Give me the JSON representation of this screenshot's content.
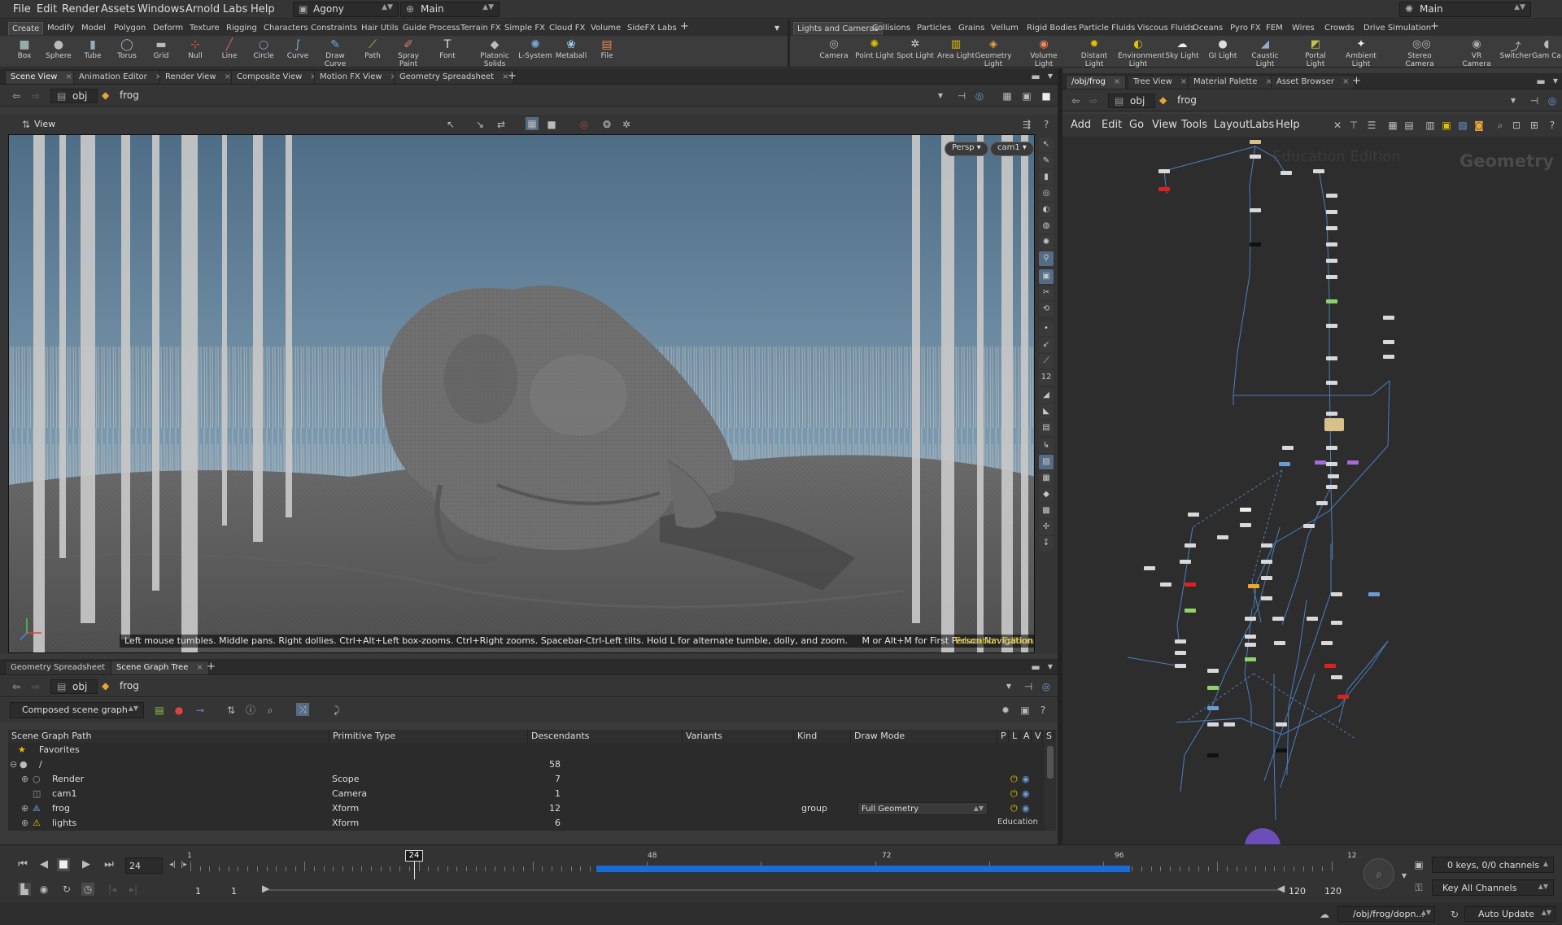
{
  "menu": [
    "File",
    "Edit",
    "Render",
    "Assets",
    "Windows",
    "Arnold",
    "Labs",
    "Help"
  ],
  "desktop": "Agony",
  "context": "Main",
  "right_context": "Main",
  "shelf_tabs_left": [
    "Create",
    "Modify",
    "Model",
    "Polygon",
    "Deform",
    "Texture",
    "Rigging",
    "Characters",
    "Constraints",
    "Hair Utils",
    "Guide Process",
    "Terrain FX",
    "Simple FX",
    "Cloud FX",
    "Volume",
    "SideFX Labs"
  ],
  "shelf_tabs_right": [
    "Lights and Cameras",
    "Collisions",
    "Particles",
    "Grains",
    "Vellum",
    "Rigid Bodies",
    "Particle Fluids",
    "Viscous Fluids",
    "Oceans",
    "Pyro FX",
    "FEM",
    "Wires",
    "Crowds",
    "Drive Simulation"
  ],
  "tools_left": [
    "Box",
    "Sphere",
    "Tube",
    "Torus",
    "Grid",
    "Null",
    "Line",
    "Circle",
    "Curve",
    "Draw Curve",
    "Path",
    "Spray Paint",
    "Font",
    "Platonic Solids",
    "L-System",
    "Metaball",
    "File"
  ],
  "tools_right": [
    "Camera",
    "Point Light",
    "Spot Light",
    "Area Light",
    "Geometry Light",
    "Volume Light",
    "Distant Light",
    "Environment Light",
    "Sky Light",
    "GI Light",
    "Caustic Light",
    "Portal Light",
    "Ambient Light",
    "VR Camera",
    "Switcher",
    "Gam Ca"
  ],
  "tools_right_extra": [
    "Stereo Camera"
  ],
  "pane_tabs_top": [
    "Scene View",
    "Animation Editor",
    "Render View",
    "Composite View",
    "Motion FX View",
    "Geometry Spreadsheet"
  ],
  "pane_tabs_right": [
    "/obj/frog",
    "Tree View",
    "Material Palette",
    "Asset Browser"
  ],
  "path": {
    "obj": "obj",
    "node": "frog"
  },
  "view": {
    "title": "View",
    "persp": "Persp",
    "cam": "cam1",
    "hint": "Left mouse tumbles. Middle pans. Right dollies. Ctrl+Alt+Left box-zooms. Ctrl+Right zooms. Spacebar-Ctrl-Left tilts. Hold L for alternate tumble, dolly, and zoom.     M or Alt+M for First Person Navigation.",
    "edu": "Education Edition"
  },
  "network": {
    "menus": [
      "Add",
      "Edit",
      "Go",
      "View",
      "Tools",
      "Layout",
      "Labs",
      "Help"
    ],
    "watermark": "Geometry",
    "edu_watermark": "Education Edition"
  },
  "bottom_tabs": [
    "Geometry Spreadsheet",
    "Scene Graph Tree"
  ],
  "scene_graph": {
    "mode": "Composed scene graph",
    "columns": [
      "Scene Graph Path",
      "Primitive Type",
      "Descendants",
      "Variants",
      "Kind",
      "Draw Mode",
      "P",
      "L",
      "A",
      "V",
      "S"
    ],
    "rows": [
      {
        "name": "Favorites",
        "type": "",
        "desc": "",
        "kind": "",
        "draw": ""
      },
      {
        "name": "/",
        "type": "",
        "desc": "58",
        "kind": "",
        "draw": ""
      },
      {
        "name": "Render",
        "type": "Scope",
        "desc": "7",
        "kind": "",
        "draw": ""
      },
      {
        "name": "cam1",
        "type": "Camera",
        "desc": "1",
        "kind": "",
        "draw": ""
      },
      {
        "name": "frog",
        "type": "Xform",
        "desc": "12",
        "kind": "group",
        "draw": "Full Geometry"
      },
      {
        "name": "lights",
        "type": "Xform",
        "desc": "6",
        "kind": "",
        "draw": ""
      }
    ],
    "edu": "Education"
  },
  "timeline": {
    "frame": "24",
    "current": "24",
    "ticks": [
      "1",
      "48",
      "72",
      "96",
      "12"
    ],
    "start": "1",
    "start2": "1",
    "end": "120",
    "end2": "120",
    "playback_range_fraction": [
      0.35,
      0.81
    ]
  },
  "channels": {
    "keys": "0 keys, 0/0 channels",
    "key_all": "Key All Channels"
  },
  "status": {
    "path": "/obj/frog/dopn...",
    "update": "Auto Update"
  }
}
